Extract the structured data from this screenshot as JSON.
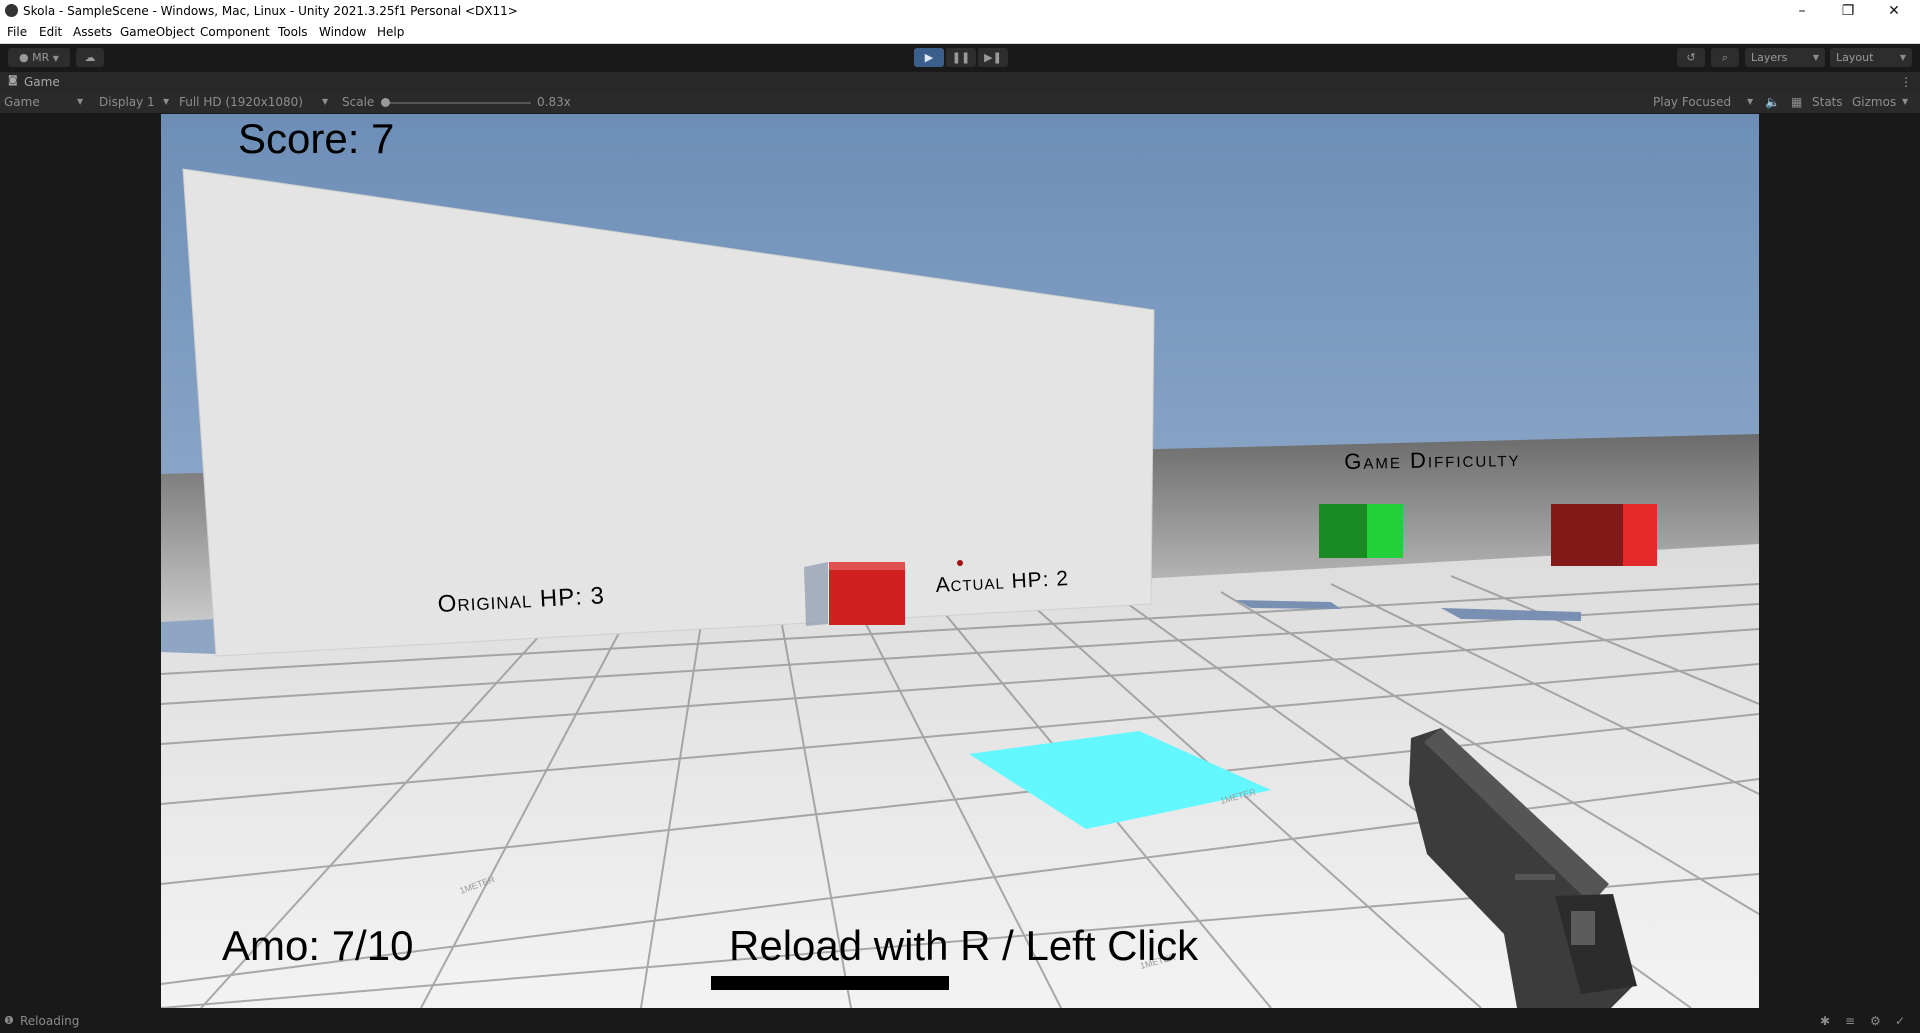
{
  "window": {
    "title": "Skola - SampleScene - Windows, Mac, Linux - Unity 2021.3.25f1 Personal <DX11>",
    "controls": {
      "minimize": "–",
      "maximize": "❐",
      "close": "✕"
    }
  },
  "menu": [
    "File",
    "Edit",
    "Assets",
    "GameObject",
    "Component",
    "Tools",
    "Window",
    "Help"
  ],
  "toolbar": {
    "account_label": "MR",
    "play_icons": {
      "play": "▶",
      "pause": "❚❚",
      "step": "▶❚"
    },
    "layers_label": "Layers",
    "layout_label": "Layout"
  },
  "tab": {
    "label": "Game",
    "more": "⋮"
  },
  "gamebar": {
    "mode": "Game",
    "display": "Display 1",
    "resolution": "Full HD (1920x1080)",
    "scale_label": "Scale",
    "scale_value": "0.83x",
    "play_mode": "Play Focused",
    "stats": "Stats",
    "gizmos": "Gizmos"
  },
  "game": {
    "score": "Score: 7",
    "ammo": "Amo: 7/10",
    "reload": "Reload with R / Left Click",
    "reload_progress": 0.36,
    "original_hp": "Original HP: 3",
    "actual_hp": "Actual HP: 2",
    "difficulty": "Game Difficulty",
    "floor_label": "1METER"
  },
  "colors": {
    "sky_top": "#6e8fb8",
    "sky_bottom": "#aec3d9",
    "floor": "#e9e9e9",
    "wall": "#e3e3e3",
    "target": "#d42323",
    "easy": "#22d13a",
    "hard": "#9a1f1f",
    "pad": "#63f7ff",
    "gun": "#3a3a3a"
  },
  "status": {
    "text": "Reloading"
  }
}
